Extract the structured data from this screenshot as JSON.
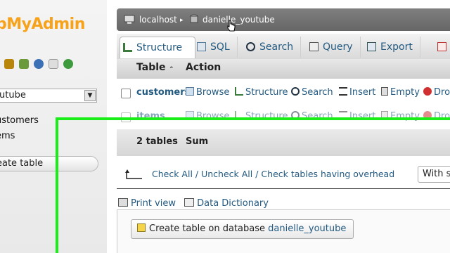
{
  "nav": {
    "logo": "pMyAdmin",
    "db_select": "utube",
    "tables": [
      "ustomers",
      "ems"
    ],
    "create_table": "eate table"
  },
  "breadcrumb": {
    "server": "localhost",
    "database": "danielle_youtube"
  },
  "tabs": [
    {
      "label": "Structure",
      "icon": "structure-icon"
    },
    {
      "label": "SQL",
      "icon": "sql-icon"
    },
    {
      "label": "Search",
      "icon": "search-icon"
    },
    {
      "label": "Query",
      "icon": "query-icon"
    },
    {
      "label": "Export",
      "icon": "export-icon"
    }
  ],
  "table_header": {
    "table": "Table",
    "sort": "⌃",
    "action": "Action"
  },
  "rows": [
    {
      "name": "customers"
    },
    {
      "name": "items"
    }
  ],
  "actions": {
    "browse": "Browse",
    "structure": "Structure",
    "search": "Search",
    "insert": "Insert",
    "empty": "Empty",
    "drop": "Dro"
  },
  "summary": {
    "count": "2 tables",
    "sum": "Sum"
  },
  "check": {
    "check_all": "Check All",
    "sep1": " / ",
    "uncheck_all": "Uncheck All",
    "sep2": " / ",
    "overhead": "Check tables having overhead",
    "with_selected": "With sele"
  },
  "links": {
    "print_view": "Print view",
    "data_dictionary": "Data Dictionary"
  },
  "create": {
    "label": "Create table on database ",
    "db": "danielle_youtube"
  },
  "colors": {
    "highlight": "#19ee19",
    "link": "#235a81",
    "logo": "#f7a21b"
  }
}
